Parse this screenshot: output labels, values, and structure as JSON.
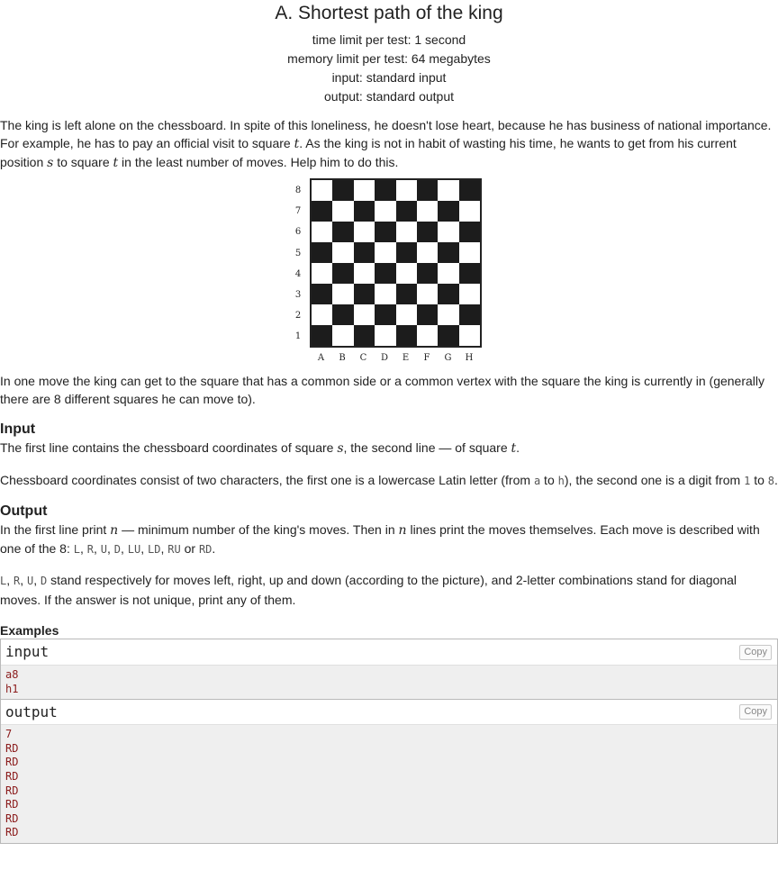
{
  "problem": {
    "title": "A. Shortest path of the king",
    "limits": [
      "time limit per test: 1 second",
      "memory limit per test: 64 megabytes",
      "input: standard input",
      "output: standard output"
    ]
  },
  "statement": {
    "p1_a": "The king is left alone on the chessboard. In spite of this loneliness, he doesn't lose heart, because he has business of national importance. For example, he has to pay an official visit to square ",
    "p1_t1": "t",
    "p1_b": ". As the king is not in habit of wasting his time, he wants to get from his current position ",
    "p1_s": "s",
    "p1_c": " to square ",
    "p1_t2": "t",
    "p1_d": " in the least number of moves. Help him to do this.",
    "p2": "In one move the king can get to the square that has a common side or a common vertex with the square the king is currently in (generally there are 8 different squares he can move to)."
  },
  "board": {
    "ranks": [
      "8",
      "7",
      "6",
      "5",
      "4",
      "3",
      "2",
      "1"
    ],
    "files": [
      "A",
      "B",
      "C",
      "D",
      "E",
      "F",
      "G",
      "H"
    ]
  },
  "input_section": {
    "title": "Input",
    "l1_a": "The first line contains the chessboard coordinates of square ",
    "l1_s": "s",
    "l1_b": ", the second line — of square ",
    "l1_t": "t",
    "l1_c": ".",
    "l2_a": "Chessboard coordinates consist of two characters, the first one is a lowercase Latin letter (from ",
    "l2_from": "a",
    "l2_to_word": " to ",
    "l2_to": "h",
    "l2_b": "), the second one is a digit from ",
    "l2_d1": "1",
    "l2_d_to": " to ",
    "l2_d8": "8",
    "l2_end": "."
  },
  "output_section": {
    "title": "Output",
    "l1_a": "In the first line print ",
    "l1_n1": "n",
    "l1_b": " — minimum number of the king's moves. Then in ",
    "l1_n2": "n",
    "l1_c": " lines print the moves themselves. Each move is described with one of the 8: ",
    "moves": [
      "L",
      "R",
      "U",
      "D",
      "LU",
      "LD",
      "RU",
      "RD"
    ],
    "sep": ", ",
    "or_word": " or ",
    "l1_end": ".",
    "l2_moves": [
      "L",
      "R",
      "U",
      "D"
    ],
    "l2_rest": " stand respectively for moves left, right, up and down (according to the picture), and 2-letter combinations stand for diagonal moves. If the answer is not unique, print any of them."
  },
  "examples": {
    "title": "Examples",
    "input_label": "input",
    "output_label": "output",
    "copy_label": "Copy",
    "input_lines": [
      "a8",
      "h1"
    ],
    "output_lines": [
      "7",
      "RD",
      "RD",
      "RD",
      "RD",
      "RD",
      "RD",
      "RD"
    ]
  }
}
